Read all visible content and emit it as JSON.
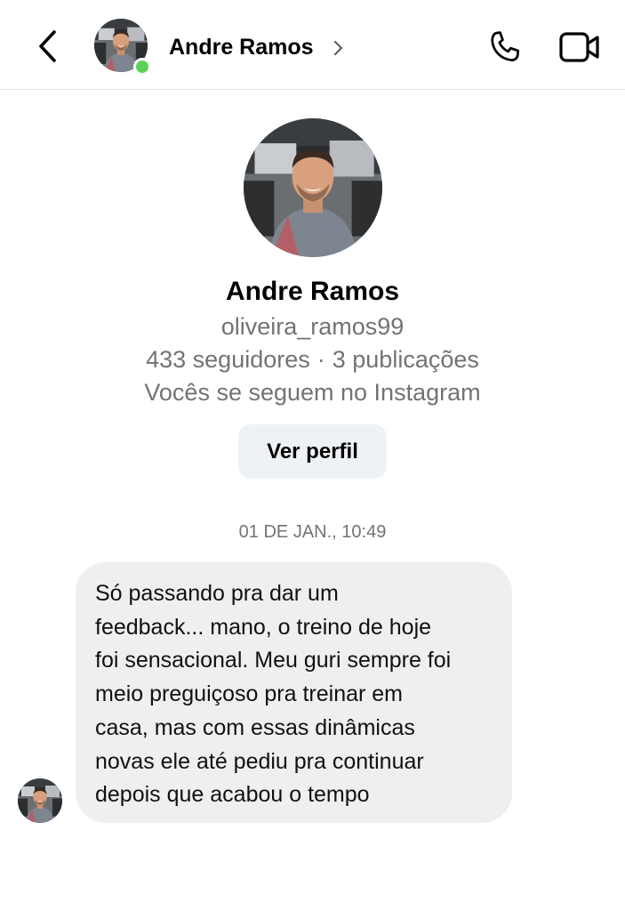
{
  "header": {
    "contact_name": "Andre Ramos",
    "online_status_color": "#5cd15a",
    "icons": [
      "back-arrow-icon",
      "chevron-right-icon",
      "phone-icon",
      "video-camera-icon"
    ]
  },
  "profile": {
    "name": "Andre Ramos",
    "username": "oliveira_ramos99",
    "followers": "433 seguidores",
    "separator": "·",
    "posts": "3 publicações",
    "mutual": "Vocês se seguem no Instagram",
    "view_profile_label": "Ver perfil"
  },
  "conversation": {
    "timestamp": "01 DE JAN., 10:49",
    "messages": [
      {
        "sender": "Andre Ramos",
        "text": "Só passando pra dar um\nfeedback... mano, o treino de hoje\nfoi sensacional. Meu guri sempre foi\nmeio preguiçoso pra treinar em\ncasa, mas com essas dinâmicas\nnovas ele até pediu pra continuar\ndepois que acabou o tempo"
      }
    ]
  }
}
